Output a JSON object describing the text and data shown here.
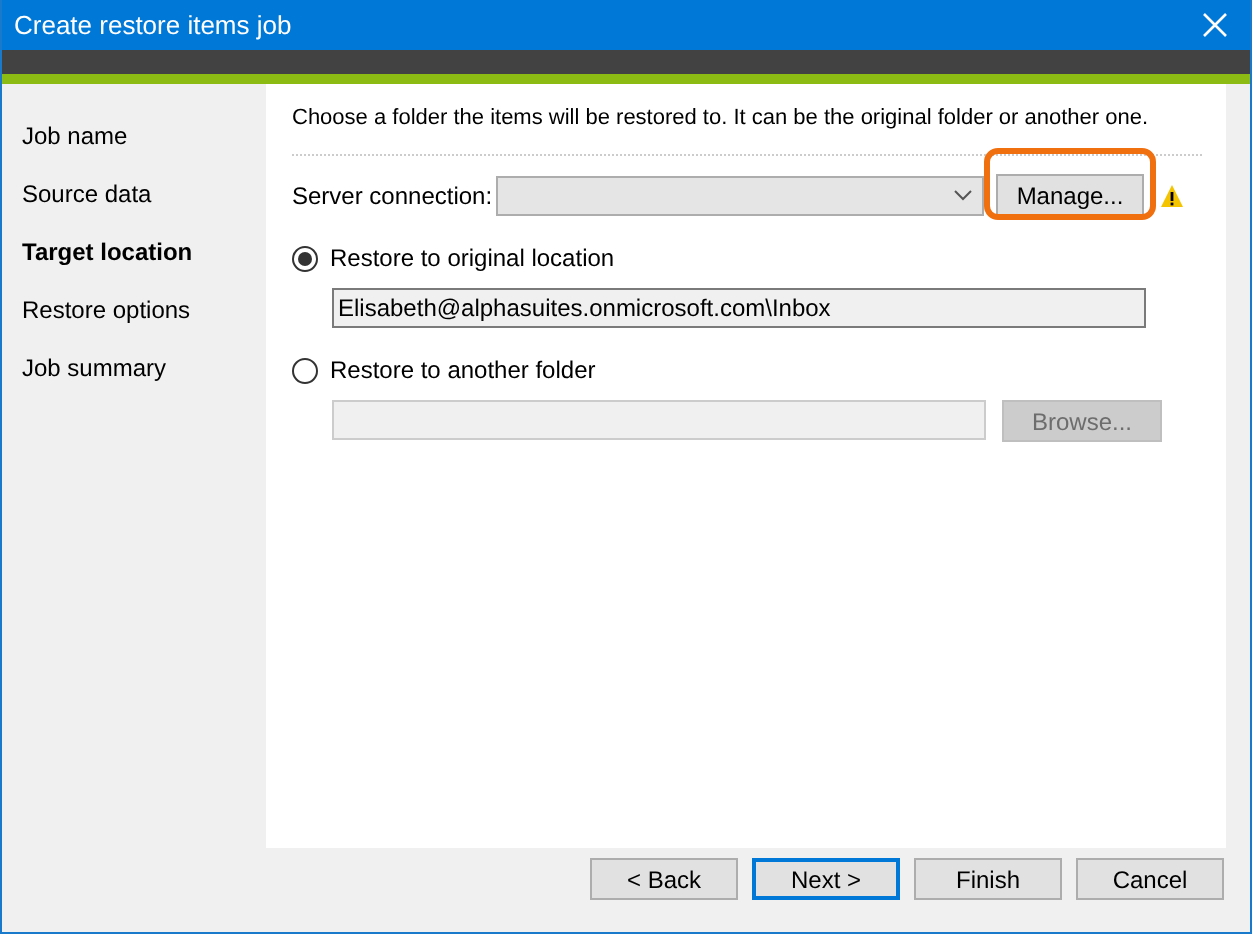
{
  "window": {
    "title": "Create restore items job"
  },
  "sidebar": {
    "items": [
      {
        "label": "Job name",
        "selected": false
      },
      {
        "label": "Source data",
        "selected": false
      },
      {
        "label": "Target location",
        "selected": true
      },
      {
        "label": "Restore options",
        "selected": false
      },
      {
        "label": "Job summary",
        "selected": false
      }
    ]
  },
  "content": {
    "intro": "Choose a folder the items will be restored to. It can be the original folder or another one.",
    "server_connection": {
      "label": "Server connection:",
      "manage_button": {
        "label": "Manage...",
        "highlighted": true
      },
      "warning": true
    },
    "options": [
      {
        "label": "Restore to original location",
        "selected": true,
        "field": {
          "value": "Elisabeth@alphasuites.onmicrosoft.com\\Inbox"
        }
      },
      {
        "label": "Restore to another folder",
        "selected": false,
        "button": {
          "label": "Browse...",
          "disabled": true
        }
      }
    ]
  },
  "buttons": [
    {
      "label": "< Back",
      "default": false
    },
    {
      "label": "Next >",
      "default": true
    },
    {
      "label": "Finish",
      "default": false
    },
    {
      "label": "Cancel",
      "default": false
    }
  ]
}
